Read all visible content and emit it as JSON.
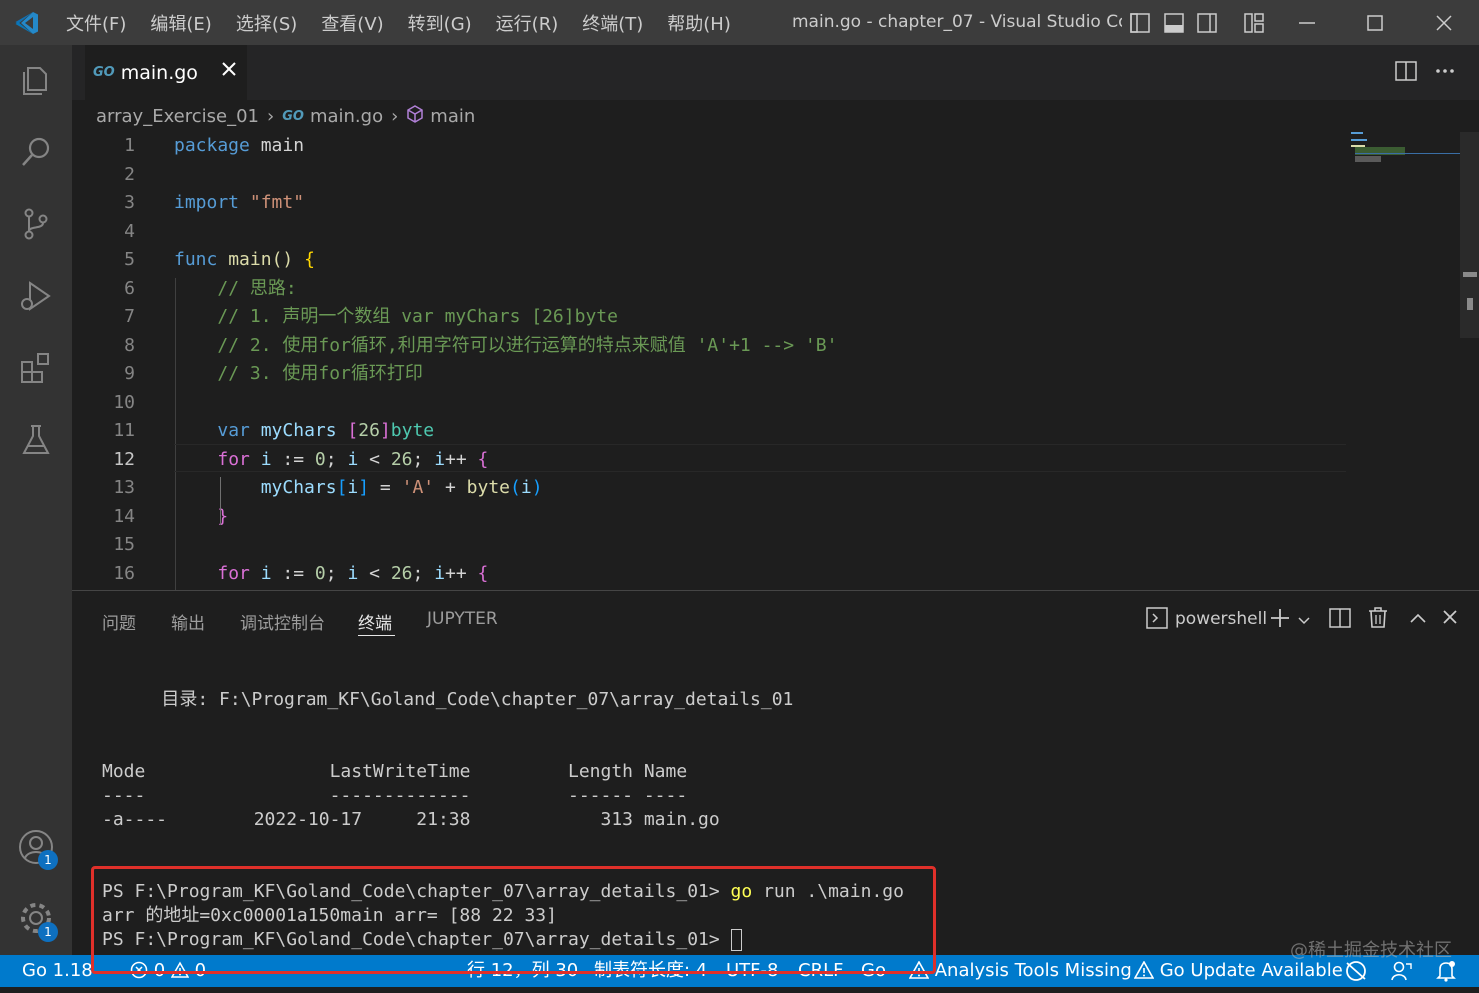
{
  "menu": [
    "文件(F)",
    "编辑(E)",
    "选择(S)",
    "查看(V)",
    "转到(G)",
    "运行(R)",
    "终端(T)",
    "帮助(H)"
  ],
  "window_title": "main.go - chapter_07 - Visual Studio Co...",
  "tab": {
    "label": "main.go",
    "go_badge": "GO"
  },
  "breadcrumb": {
    "folder": "array_Exercise_01",
    "file": "main.go",
    "symbol": "main"
  },
  "code_lines": [
    [
      {
        "t": "package",
        "c": "kw"
      },
      {
        "t": " main"
      }
    ],
    [],
    [
      {
        "t": "import",
        "c": "kw"
      },
      {
        "t": " "
      },
      {
        "t": "\"fmt\"",
        "c": "st"
      }
    ],
    [],
    [
      {
        "t": "func",
        "c": "kw"
      },
      {
        "t": " "
      },
      {
        "t": "main",
        "c": "fn"
      },
      {
        "t": "()",
        "c": "fn"
      },
      {
        "t": " "
      },
      {
        "t": "{",
        "c": "br1"
      }
    ],
    [
      {
        "t": "    "
      },
      {
        "t": "// 思路:",
        "c": "cm"
      }
    ],
    [
      {
        "t": "    "
      },
      {
        "t": "// 1. 声明一个数组 var myChars [26]byte",
        "c": "cm"
      }
    ],
    [
      {
        "t": "    "
      },
      {
        "t": "// 2. 使用for循环,利用字符可以进行运算的特点来赋值 'A'+1 --> 'B'",
        "c": "cm"
      }
    ],
    [
      {
        "t": "    "
      },
      {
        "t": "// 3. 使用for循环打印",
        "c": "cm"
      }
    ],
    [],
    [
      {
        "t": "    "
      },
      {
        "t": "var",
        "c": "kw"
      },
      {
        "t": " "
      },
      {
        "t": "myChars",
        "c": "vr"
      },
      {
        "t": " "
      },
      {
        "t": "[",
        "c": "br2"
      },
      {
        "t": "26",
        "c": "nm"
      },
      {
        "t": "]",
        "c": "br2"
      },
      {
        "t": "byte",
        "c": "ty"
      }
    ],
    [
      {
        "t": "    "
      },
      {
        "t": "for",
        "c": "br2"
      },
      {
        "t": " "
      },
      {
        "t": "i",
        "c": "vr"
      },
      {
        "t": " := "
      },
      {
        "t": "0",
        "c": "nm"
      },
      {
        "t": "; "
      },
      {
        "t": "i",
        "c": "vr"
      },
      {
        "t": " < "
      },
      {
        "t": "26",
        "c": "nm"
      },
      {
        "t": "; "
      },
      {
        "t": "i",
        "c": "vr"
      },
      {
        "t": "++ "
      },
      {
        "t": "{",
        "c": "br2"
      }
    ],
    [
      {
        "t": "        "
      },
      {
        "t": "myChars",
        "c": "vr"
      },
      {
        "t": "[",
        "c": "br3"
      },
      {
        "t": "i",
        "c": "vr"
      },
      {
        "t": "]",
        "c": "br3"
      },
      {
        "t": " = "
      },
      {
        "t": "'A'",
        "c": "st"
      },
      {
        "t": " + "
      },
      {
        "t": "byte",
        "c": "fn"
      },
      {
        "t": "(",
        "c": "br3"
      },
      {
        "t": "i",
        "c": "vr"
      },
      {
        "t": ")",
        "c": "br3"
      }
    ],
    [
      {
        "t": "    "
      },
      {
        "t": "}",
        "c": "br2"
      }
    ],
    [],
    [
      {
        "t": "    "
      },
      {
        "t": "for",
        "c": "br2"
      },
      {
        "t": " "
      },
      {
        "t": "i",
        "c": "vr"
      },
      {
        "t": " := "
      },
      {
        "t": "0",
        "c": "nm"
      },
      {
        "t": "; "
      },
      {
        "t": "i",
        "c": "vr"
      },
      {
        "t": " < "
      },
      {
        "t": "26",
        "c": "nm"
      },
      {
        "t": "; "
      },
      {
        "t": "i",
        "c": "vr"
      },
      {
        "t": "++ "
      },
      {
        "t": "{",
        "c": "br2"
      }
    ]
  ],
  "panel_tabs": [
    "问题",
    "输出",
    "调试控制台",
    "终端",
    "JUPYTER"
  ],
  "terminal_shell": "powershell",
  "terminal_lines": [
    "    目录: F:\\Program_KF\\Goland_Code\\chapter_07\\array_details_01",
    "Mode                 LastWriteTime         Length Name",
    "----                 -------------         ------ ----",
    "-a----        2022-10-17     21:38            313 main.go",
    "PS F:\\Program_KF\\Goland_Code\\chapter_07\\array_details_01> ",
    "arr 的地址=0xc00001a150main arr= [88 22 33]",
    "PS F:\\Program_KF\\Goland_Code\\chapter_07\\array_details_01> "
  ],
  "terminal_cmd": {
    "go": "go",
    "rest": " run .\\main.go"
  },
  "status": {
    "go_version": "Go 1.18",
    "errors": "0",
    "warnings": "0",
    "position": "行 12，列 30",
    "indent": "制表符长度: 4",
    "encoding": "UTF-8",
    "eol": "CRLF",
    "language": "Go",
    "analysis": "Analysis Tools Missing",
    "update": "Go Update Available"
  },
  "badges": {
    "account": "1",
    "settings": "1"
  },
  "watermark": "@稀土掘金技术社区"
}
